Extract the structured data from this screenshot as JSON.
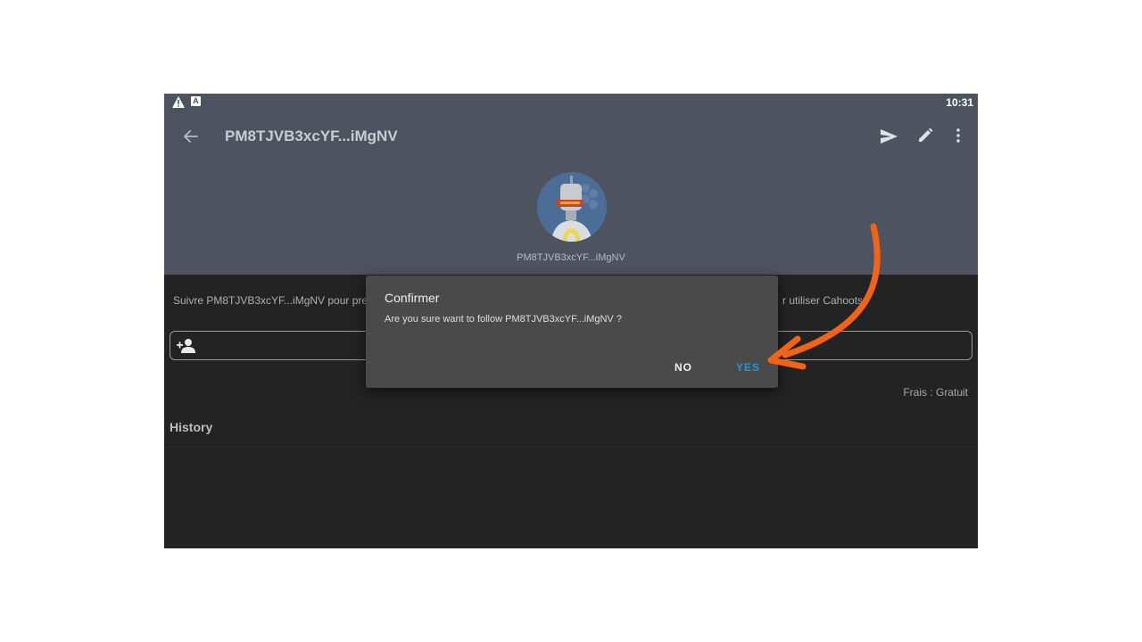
{
  "statusbar": {
    "time": "10:31",
    "badge": "A",
    "icons": [
      "warning-icon",
      "notification-a-icon"
    ]
  },
  "appbar": {
    "title": "PM8TJVB3xcYF...iMgNV",
    "icons": [
      "arrow-back-icon",
      "send-icon",
      "edit-pencil-icon",
      "more-vert-icon"
    ]
  },
  "profile": {
    "caption": "PM8TJVB3xcYF...iMgNV",
    "avatar": "robot-avatar"
  },
  "content": {
    "follow_text": "Suivre PM8TJVB3xcYF...iMgNV pour pren",
    "follow_text_end": "r utiliser Cahoots",
    "fee": "Frais : Gratuit",
    "history": "History"
  },
  "dialog": {
    "title": "Confirmer",
    "message": "Are you sure want to follow PM8TJVB3xcYF...iMgNV ?",
    "no_label": "NO",
    "yes_label": "YES"
  },
  "colors": {
    "header": "#4d535f",
    "background": "#232323",
    "dialog": "#4a4a4a",
    "accent": "#1f94e0",
    "annotation_arrow": "#f26315"
  }
}
